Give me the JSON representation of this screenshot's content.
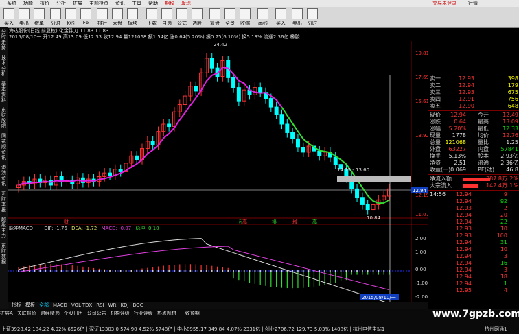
{
  "menu": {
    "items": [
      "系统",
      "功能",
      "报价",
      "分析",
      "扩展",
      "主题投资",
      "资讯",
      "工具",
      "帮助",
      "期权",
      "发现"
    ],
    "right": [
      "交易未登录",
      "行情"
    ]
  },
  "toolbar": {
    "buttons": [
      "买入",
      "卖出",
      "撤单",
      "分时",
      "K线",
      "F6",
      "排行",
      "大盘",
      "板块",
      "下载",
      "自选",
      "公式",
      "选股",
      "复盘",
      "全景",
      "收缩",
      "画线",
      "买入",
      "卖出",
      "分时"
    ]
  },
  "left_tabs": [
    "分时走势",
    "技术分析",
    "基本资料",
    "东财股吧",
    "同花顺资讯",
    "港澳资讯",
    "东财季报",
    "超级主力",
    "东财数据"
  ],
  "chart_header": {
    "line1": "海达股份(日线 前复权) 化金钟刀 11.83 11.83",
    "line2": "2015/08/10一 开12.49 高13.09 低12.33 收12.94 量121068 额1.54亿 涨0.64(5.20%) 振0.75(6.10%) 换5.13% 流通2.36亿 橡胶"
  },
  "price_labels": [
    {
      "text": "24.42",
      "value": 24.42
    },
    {
      "text": "14.15 - 13.60",
      "value": 14.15
    },
    {
      "text": "10.84",
      "value": 10.84
    },
    {
      "text": "12.94",
      "value": 12.94
    }
  ],
  "price_axis": [
    "19.81",
    "17.69",
    "15.61",
    "13.92",
    "12.94",
    "12.19",
    "11.07"
  ],
  "event_tags": [
    "财",
    "科",
    "高",
    "换",
    "增",
    "高"
  ],
  "macd": {
    "title": "脉冲MACD",
    "dif": "DIF: -1.76",
    "dea": "DEA: -1.72",
    "macd": "MACD: -0.07",
    "pulse": "脉冲: 0.10",
    "axis": [
      "2.00",
      "1.00",
      "0.00",
      "-1.00",
      "-2.00"
    ],
    "date_label": "2015/08/10/一"
  },
  "indicator_tabs": [
    "指标",
    "模板",
    "全部",
    "MACD",
    "VOL-TDX",
    "RSI",
    "WR",
    "KDJ",
    "BOC"
  ],
  "sub_tabs": [
    "扩展A",
    "关联报价",
    "财经精选",
    "个股日历",
    "公司公告",
    "机构评级",
    "行业评级",
    "热点题材",
    "一致预期"
  ],
  "order_book": {
    "sell": [
      {
        "label": "卖一",
        "price": "12.93",
        "vol": "398"
      },
      {
        "label": "卖二",
        "price": "12.94",
        "vol": "179"
      },
      {
        "label": "卖三",
        "price": "12.93",
        "vol": "675"
      },
      {
        "label": "卖四",
        "price": "12.91",
        "vol": "756"
      },
      {
        "label": "卖五",
        "price": "12.90",
        "vol": "648"
      }
    ]
  },
  "quote": [
    {
      "l1": "现价",
      "v1": "12.94",
      "l2": "今开",
      "v2": "12.49"
    },
    {
      "l1": "涨跌",
      "v1": "0.64",
      "l2": "最高",
      "v2": "13.09"
    },
    {
      "l1": "涨幅",
      "v1": "5.20%",
      "l2": "最低",
      "v2": "12.33"
    },
    {
      "l1": "现量",
      "v1": "1778",
      "l2": "均价",
      "v2": "12.76"
    },
    {
      "l1": "总量",
      "v1": "121068",
      "l2": "量比",
      "v2": "1.25"
    },
    {
      "l1": "外盘",
      "v1": "63227",
      "l2": "内盘",
      "v2": "57841"
    },
    {
      "l1": "换手",
      "v1": "5.13%",
      "l2": "股本",
      "v2": "2.93亿"
    },
    {
      "l1": "净资",
      "v1": "2.51",
      "l2": "流通",
      "v2": "2.36亿"
    },
    {
      "l1": "收益(一)",
      "v1": "0.069",
      "l2": "PE(动)",
      "v2": "46.8"
    }
  ],
  "flow": [
    {
      "label": "净流入额",
      "value": "287.8万",
      "pct": "2%"
    },
    {
      "label": "大宗流入",
      "value": "142.4万",
      "pct": "1%"
    }
  ],
  "ticks": [
    {
      "t": "14:56",
      "p": "12.94",
      "v": "9"
    },
    {
      "t": "",
      "p": "12.94",
      "v": "92"
    },
    {
      "t": "",
      "p": "12.93",
      "v": "2"
    },
    {
      "t": "",
      "p": "12.94",
      "v": "20"
    },
    {
      "t": "",
      "p": "12.94",
      "v": "22"
    },
    {
      "t": "",
      "p": "12.93",
      "v": "10"
    },
    {
      "t": "",
      "p": "12.93",
      "v": "100"
    },
    {
      "t": "",
      "p": "12.94",
      "v": "31"
    },
    {
      "t": "",
      "p": "12.94",
      "v": "10"
    },
    {
      "t": "",
      "p": "12.94",
      "v": "3"
    },
    {
      "t": "",
      "p": "12.94",
      "v": "16"
    },
    {
      "t": "",
      "p": "12.94",
      "v": "3"
    },
    {
      "t": "",
      "p": "12.94",
      "v": "18"
    },
    {
      "t": "",
      "p": "12.94",
      "v": "1"
    },
    {
      "t": "",
      "p": "12.95",
      "v": "4"
    }
  ],
  "status_bar": "上证3928.42 184.22 4.92% 6526亿 | 深证13303.0 574.90 4.52% 5748亿 | 中小8955.17 349.84 4.07% 2331亿 | 创业2706.72 129.73 5.03% 1408亿 | 杭州电信主站1",
  "status_right": "杭州网通1",
  "watermark": "www.7gpzb.com",
  "colors": {
    "up": "#ff3232",
    "down": "#00ffff",
    "ma": "#e020e0",
    "ma2": "#33dd33"
  }
}
